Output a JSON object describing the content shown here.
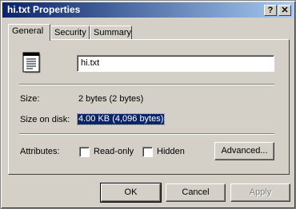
{
  "window": {
    "title": "hi.txt Properties",
    "help_button": "?",
    "close_button": "✕"
  },
  "tabs": [
    {
      "label": "General",
      "active": true
    },
    {
      "label": "Security",
      "active": false
    },
    {
      "label": "Summary",
      "active": false
    }
  ],
  "general": {
    "file_name": "hi.txt",
    "size_label": "Size:",
    "size_value": "2 bytes (2 bytes)",
    "size_on_disk_label": "Size on disk:",
    "size_on_disk_value": "4.00 KB (4,096 bytes)",
    "attributes_label": "Attributes:",
    "readonly": {
      "label": "Read-only",
      "checked": false
    },
    "hidden": {
      "label": "Hidden",
      "checked": false
    },
    "advanced_button": "Advanced..."
  },
  "buttons": {
    "ok": "OK",
    "cancel": "Cancel",
    "apply": "Apply",
    "apply_enabled": false
  },
  "icons": {
    "file_icon": "text-document-icon"
  }
}
